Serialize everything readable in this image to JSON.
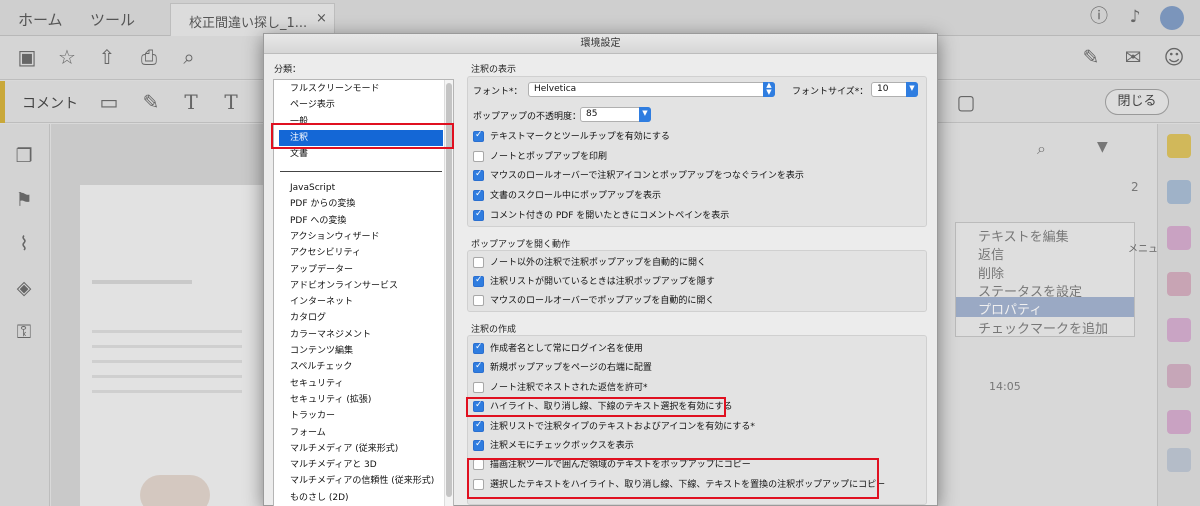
{
  "app": {
    "tab_home": "ホーム",
    "tab_tools": "ツール",
    "doc_tab": "校正間違い探し_1...",
    "doc_tab_close": "×",
    "comment_label": "コメント",
    "close_button": "閉じる",
    "context_menu": [
      "テキストを編集",
      "返信",
      "削除",
      "ステータスを設定",
      "プロパティ",
      "チェックマークを追加"
    ],
    "menu_label": "メニュー",
    "right_timestamp": "14:05",
    "page_indicator": "2"
  },
  "dialog": {
    "title": "環境設定",
    "category_label": "分類：",
    "categories_top": [
      "フルスクリーンモード",
      "ページ表示",
      "一般",
      "注釈",
      "文書"
    ],
    "selected_category": "注釈",
    "categories_bottom": [
      "JavaScript",
      "PDF からの変換",
      "PDF への変換",
      "アクションウィザード",
      "アクセシビリティ",
      "アップデーター",
      "アドビオンラインサービス",
      "インターネット",
      "カタログ",
      "カラーマネジメント",
      "コンテンツ編集",
      "スペルチェック",
      "セキュリティ",
      "セキュリティ (拡張)",
      "トラッカー",
      "フォーム",
      "マルチメディア (従来形式)",
      "マルチメディアと 3D",
      "マルチメディアの信頼性 (従来形式)",
      "ものさし (2D)"
    ],
    "display": {
      "title": "注釈の表示",
      "font_label": "フォント*：",
      "font_value": "Helvetica",
      "font_size_label": "フォントサイズ*：",
      "font_size_value": "10",
      "opacity_label": "ポップアップの不透明度：",
      "opacity_value": "85",
      "options": [
        {
          "label": "テキストマークとツールチップを有効にする",
          "checked": true
        },
        {
          "label": "ノートとポップアップを印刷",
          "checked": false
        },
        {
          "label": "マウスのロールオーバーで注釈アイコンとポップアップをつなぐラインを表示",
          "checked": true
        },
        {
          "label": "文書のスクロール中にポップアップを表示",
          "checked": true
        },
        {
          "label": "コメント付きの PDF を開いたときにコメントペインを表示",
          "checked": true
        }
      ]
    },
    "popup": {
      "title": "ポップアップを開く動作",
      "options": [
        {
          "label": "ノート以外の注釈で注釈ポップアップを自動的に開く",
          "checked": false
        },
        {
          "label": "注釈リストが開いているときは注釈ポップアップを隠す",
          "checked": true
        },
        {
          "label": "マウスのロールオーバーでポップアップを自動的に開く",
          "checked": false
        }
      ]
    },
    "creation": {
      "title": "注釈の作成",
      "options": [
        {
          "label": "作成者名として常にログイン名を使用",
          "checked": true
        },
        {
          "label": "新規ポップアップをページの右端に配置",
          "checked": true
        },
        {
          "label": "ノート注釈でネストされた返信を許可*",
          "checked": false
        },
        {
          "label": "ハイライト、取り消し線、下線のテキスト選択を有効にする",
          "checked": true
        },
        {
          "label": "注釈リストで注釈タイプのテキストおよびアイコンを有効にする*",
          "checked": true
        },
        {
          "label": "注釈メモにチェックボックスを表示",
          "checked": true
        },
        {
          "label": "描画注釈ツールで囲んだ領域のテキストをポップアップにコピー",
          "checked": false
        },
        {
          "label": "選択したテキストをハイライト、取り消し線、下線、テキストを置換の注釈ポップアップにコピー",
          "checked": false
        }
      ]
    }
  }
}
